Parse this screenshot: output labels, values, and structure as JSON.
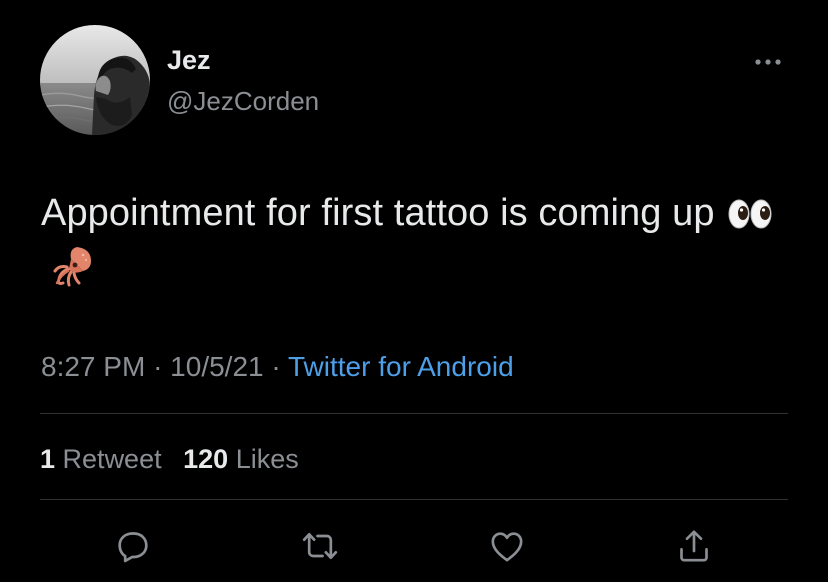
{
  "tweet": {
    "author_name": "Jez",
    "author_handle": "@JezCorden",
    "text": "Appointment for first tattoo is coming up",
    "emojis": [
      "eyes-emoji",
      "squid-emoji"
    ],
    "timestamp": "8:27 PM",
    "separator": "·",
    "date": "10/5/21",
    "source": "Twitter for Android",
    "retweet_count": "1",
    "retweet_label": "Retweet",
    "like_count": "120",
    "like_label": "Likes"
  },
  "actions": [
    "reply-icon",
    "retweet-icon",
    "like-icon",
    "share-icon"
  ],
  "colors": {
    "background": "#000000",
    "primary_text": "#e7e9ea",
    "secondary_text": "#8b8f93",
    "link": "#4d9fe8",
    "divider": "#2f3336"
  }
}
